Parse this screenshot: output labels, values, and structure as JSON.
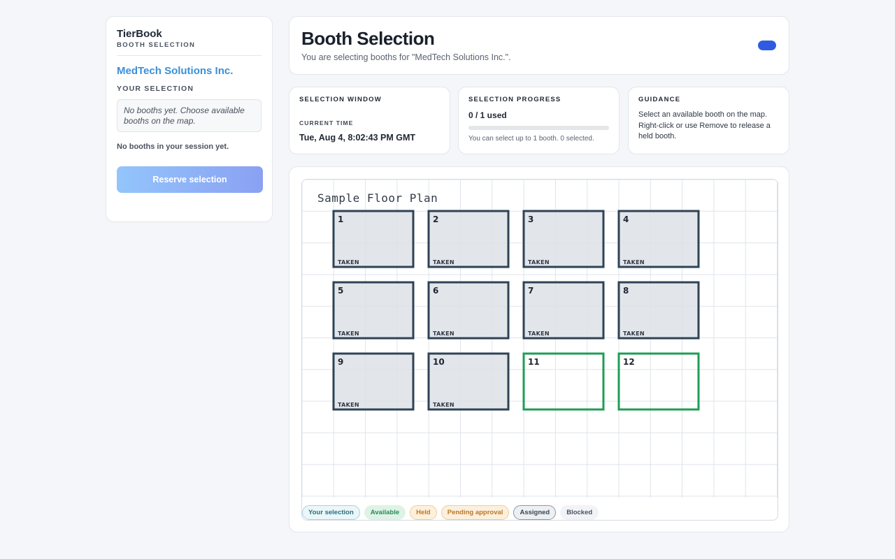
{
  "sidebar": {
    "app_title": "TierBook",
    "app_subtitle": "BOOTH SELECTION",
    "company": "MedTech Solutions Inc.",
    "your_selection_label": "YOUR SELECTION",
    "empty_selection": "No booths yet. Choose available booths on the map.",
    "session_note": "No booths in your session yet.",
    "reserve_label": "Reserve selection"
  },
  "header": {
    "title": "Booth Selection",
    "subtitle": "You are selecting booths for \"MedTech Solutions Inc.\"."
  },
  "selection_window": {
    "heading": "SELECTION WINDOW",
    "current_time_label": "CURRENT TIME",
    "current_time": "Tue, Aug 4, 8:02:43 PM GMT"
  },
  "selection_progress": {
    "heading": "SELECTION PROGRESS",
    "used_text": "0 / 1 used",
    "used": 0,
    "limit": 1,
    "note": "You can select up to 1 booth. 0 selected."
  },
  "guidance": {
    "heading": "GUIDANCE",
    "text": "Select an available booth on the map. Right-click or use Remove to release a held booth."
  },
  "floor_plan": {
    "title": "Sample Floor Plan",
    "taken_label": "TAKEN",
    "booths": [
      {
        "number": "1",
        "status": "taken"
      },
      {
        "number": "2",
        "status": "taken"
      },
      {
        "number": "3",
        "status": "taken"
      },
      {
        "number": "4",
        "status": "taken"
      },
      {
        "number": "5",
        "status": "taken"
      },
      {
        "number": "6",
        "status": "taken"
      },
      {
        "number": "7",
        "status": "taken"
      },
      {
        "number": "8",
        "status": "taken"
      },
      {
        "number": "9",
        "status": "taken"
      },
      {
        "number": "10",
        "status": "taken"
      },
      {
        "number": "11",
        "status": "available"
      },
      {
        "number": "12",
        "status": "available"
      }
    ]
  },
  "legend": {
    "your_selection": "Your selection",
    "available": "Available",
    "held": "Held",
    "pending": "Pending approval",
    "assigned": "Assigned",
    "blocked": "Blocked"
  },
  "colors": {
    "taken_stroke": "#2f4356",
    "taken_fill": "#dde2e8",
    "available_stroke": "#1f9d55",
    "accent": "#2f5be0"
  }
}
